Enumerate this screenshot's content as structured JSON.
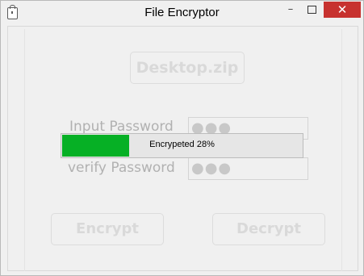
{
  "window": {
    "title": "File Encryptor",
    "controls": {
      "minimize": "–",
      "close": "✕"
    }
  },
  "file": {
    "label": "Desktop.zip"
  },
  "password": {
    "input_label": "Input Password",
    "input_value": "●●●",
    "verify_label": "verify Password",
    "verify_value": "●●●"
  },
  "progress": {
    "label": "Encrypeted 28%",
    "fraction": 0.28,
    "color": "#06b025"
  },
  "actions": {
    "encrypt": "Encrypt",
    "decrypt": "Decrypt"
  },
  "colors": {
    "close_button": "#c7322f",
    "disabled_text": "#d9d9d9"
  }
}
